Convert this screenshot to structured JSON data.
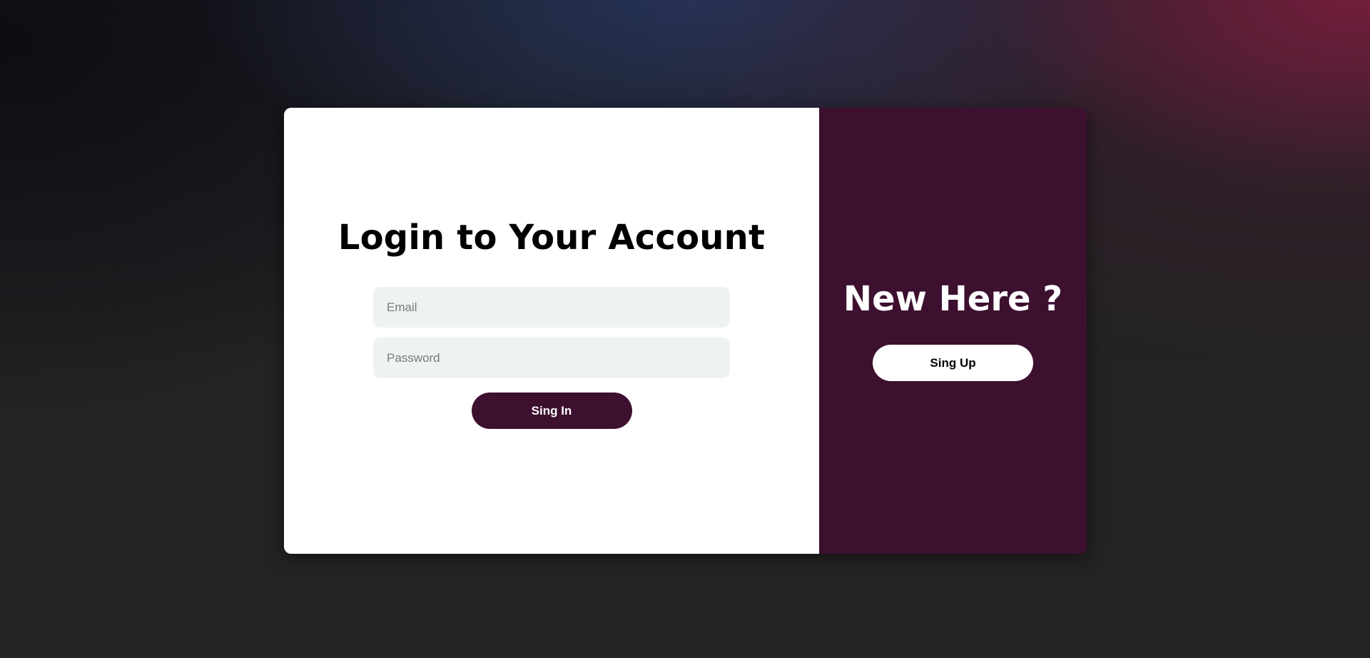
{
  "login": {
    "title": "Login to Your Account",
    "email_placeholder": "Email",
    "password_placeholder": "Password",
    "signin_label": "Sing In"
  },
  "signup": {
    "title": "New Here ?",
    "signup_label": "Sing Up"
  },
  "colors": {
    "accent": "#3d1030",
    "input_bg": "#edf3f1",
    "card_bg": "#ffffff"
  }
}
